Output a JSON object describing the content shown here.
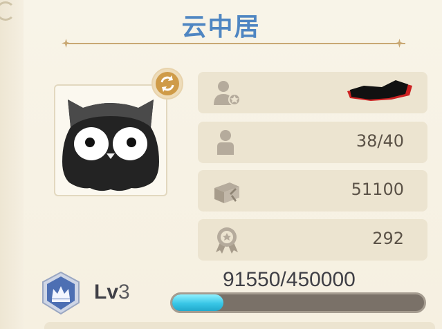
{
  "title": "云中居",
  "stats": {
    "members": "38/40",
    "funds": "51100",
    "score": "292"
  },
  "level": {
    "prefix": "Lv",
    "number": "3"
  },
  "experience": {
    "text": "91550/450000",
    "current": 91550,
    "max": 450000
  },
  "icons": {
    "swap": "swap-arrows-icon",
    "leader": "leader-person-icon",
    "members": "person-icon",
    "funds": "treasure-chest-icon",
    "score": "award-badge-icon",
    "level": "crown-badge-icon"
  },
  "colors": {
    "title": "#4f86c2",
    "exp_fill": "#38c6e6",
    "exp_track": "#7a7168"
  }
}
